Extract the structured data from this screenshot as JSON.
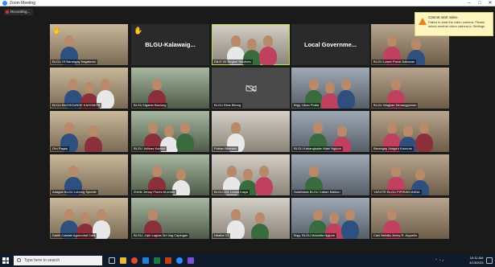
{
  "window": {
    "title": "Zoom Meeting",
    "controls": [
      "–",
      "□",
      "✕"
    ]
  },
  "recording": {
    "label": "Recording..."
  },
  "notification": {
    "title": "Cannot start video",
    "body": "Failed to start the video camera. Please select another video camera in Settings.",
    "icon": "warning-icon"
  },
  "participants": [
    {
      "name": "BLGU Of Barangay Nagakuan",
      "hand": true
    },
    {
      "name": "BLGU-Kalawaig...",
      "hand": true,
      "video": false
    },
    {
      "name": "DILG VII Region Services",
      "active": true
    },
    {
      "name": "Local Governme...",
      "video": false
    },
    {
      "name": "BLGU Lower Purok Kabucan"
    },
    {
      "name": "BLGU BUGSOUNSE KAHOMON"
    },
    {
      "name": "BLGU Ngatan Baciung"
    },
    {
      "name": "BLGU Elias Bitong",
      "camera_off": true
    },
    {
      "name": "Brgy. Ubao Pobla"
    },
    {
      "name": "BLGU Wagkan Dimanggoloan"
    },
    {
      "name": "Oro Pagay"
    },
    {
      "name": "BLGU Jollinas Kuinon"
    },
    {
      "name": "Poblac Buenavi"
    },
    {
      "name": "BLGU Kabangkalan Mani Ngipon"
    },
    {
      "name": "Barangay Jaaga's Kaunuto"
    },
    {
      "name": "Adagab BLGU Lobong Spindle"
    },
    {
      "name": "Zhelle Jenwy Flores M.ordon"
    },
    {
      "name": "BLGU-101 Lorola Inaya"
    },
    {
      "name": "Salalindab BLGU Caban Malkon"
    },
    {
      "name": "YASOTE BLGU PIPIRAN MANA"
    },
    {
      "name": "Dalith Calalab Agronobal Cala"
    },
    {
      "name": "BLGU- Jojin Lagtas 3rd Ilog Capingan"
    },
    {
      "name": "Healbe Cl"
    },
    {
      "name": "Brgy. BLGU Maholita Ngipon"
    },
    {
      "name": "Casi Nefalia Jenny R. Arguello"
    }
  ],
  "taskbar": {
    "search_placeholder": "Type here to search",
    "time": "10:11 AM",
    "date": "4/13/2021"
  },
  "colors": {
    "active_speaker": "#b4e14c",
    "raised_hand": "#f5c518",
    "taskbar": "#0f1b2b"
  }
}
